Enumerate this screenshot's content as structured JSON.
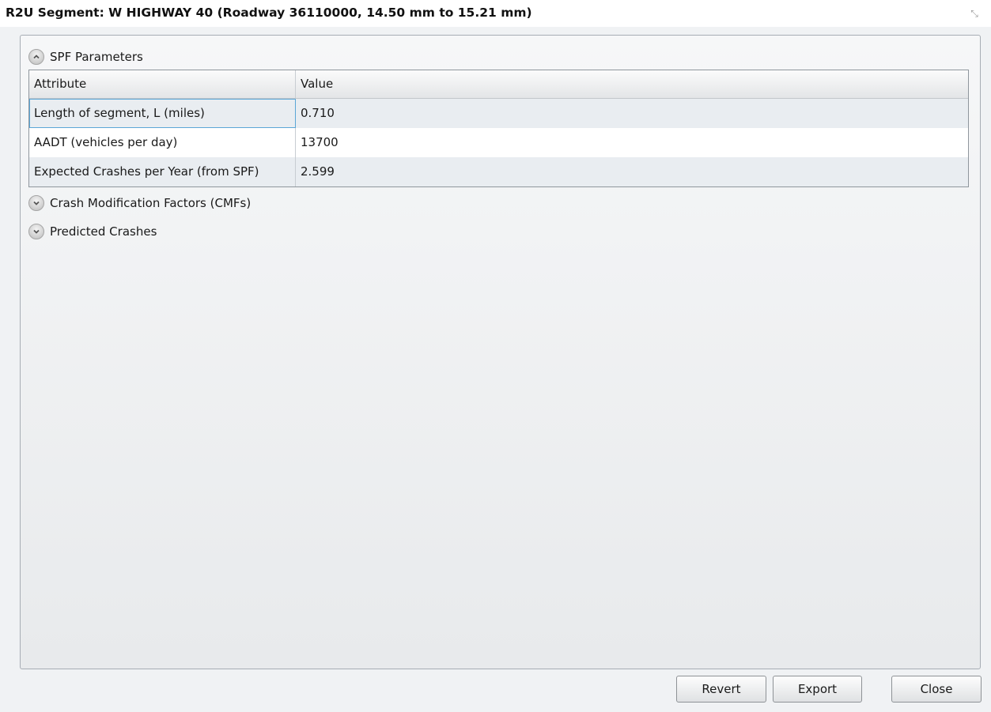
{
  "window": {
    "title": "R2U Segment: W HIGHWAY 40 (Roadway 36110000, 14.50 mm to 15.21 mm)",
    "close_glyph": "⤡"
  },
  "sections": {
    "spf": {
      "label": "SPF Parameters",
      "expanded": true,
      "columns": [
        "Attribute",
        "Value"
      ],
      "rows": [
        {
          "attribute": "Length of segment, L (miles)",
          "value": "0.710"
        },
        {
          "attribute": "AADT (vehicles per day)",
          "value": "13700"
        },
        {
          "attribute": "Expected Crashes per Year (from SPF)",
          "value": "2.599"
        }
      ]
    },
    "cmf": {
      "label": "Crash Modification Factors (CMFs)",
      "expanded": false
    },
    "predicted": {
      "label": "Predicted Crashes",
      "expanded": false
    }
  },
  "buttons": {
    "revert": "Revert",
    "export": "Export",
    "close": "Close"
  },
  "icons": {
    "collapse": "chevron-up-icon",
    "expand": "chevron-down-icon",
    "close": "resize-close-icon"
  },
  "colors": {
    "selection_border": "#5aa6d6",
    "alt_row": "#e9edf1"
  }
}
